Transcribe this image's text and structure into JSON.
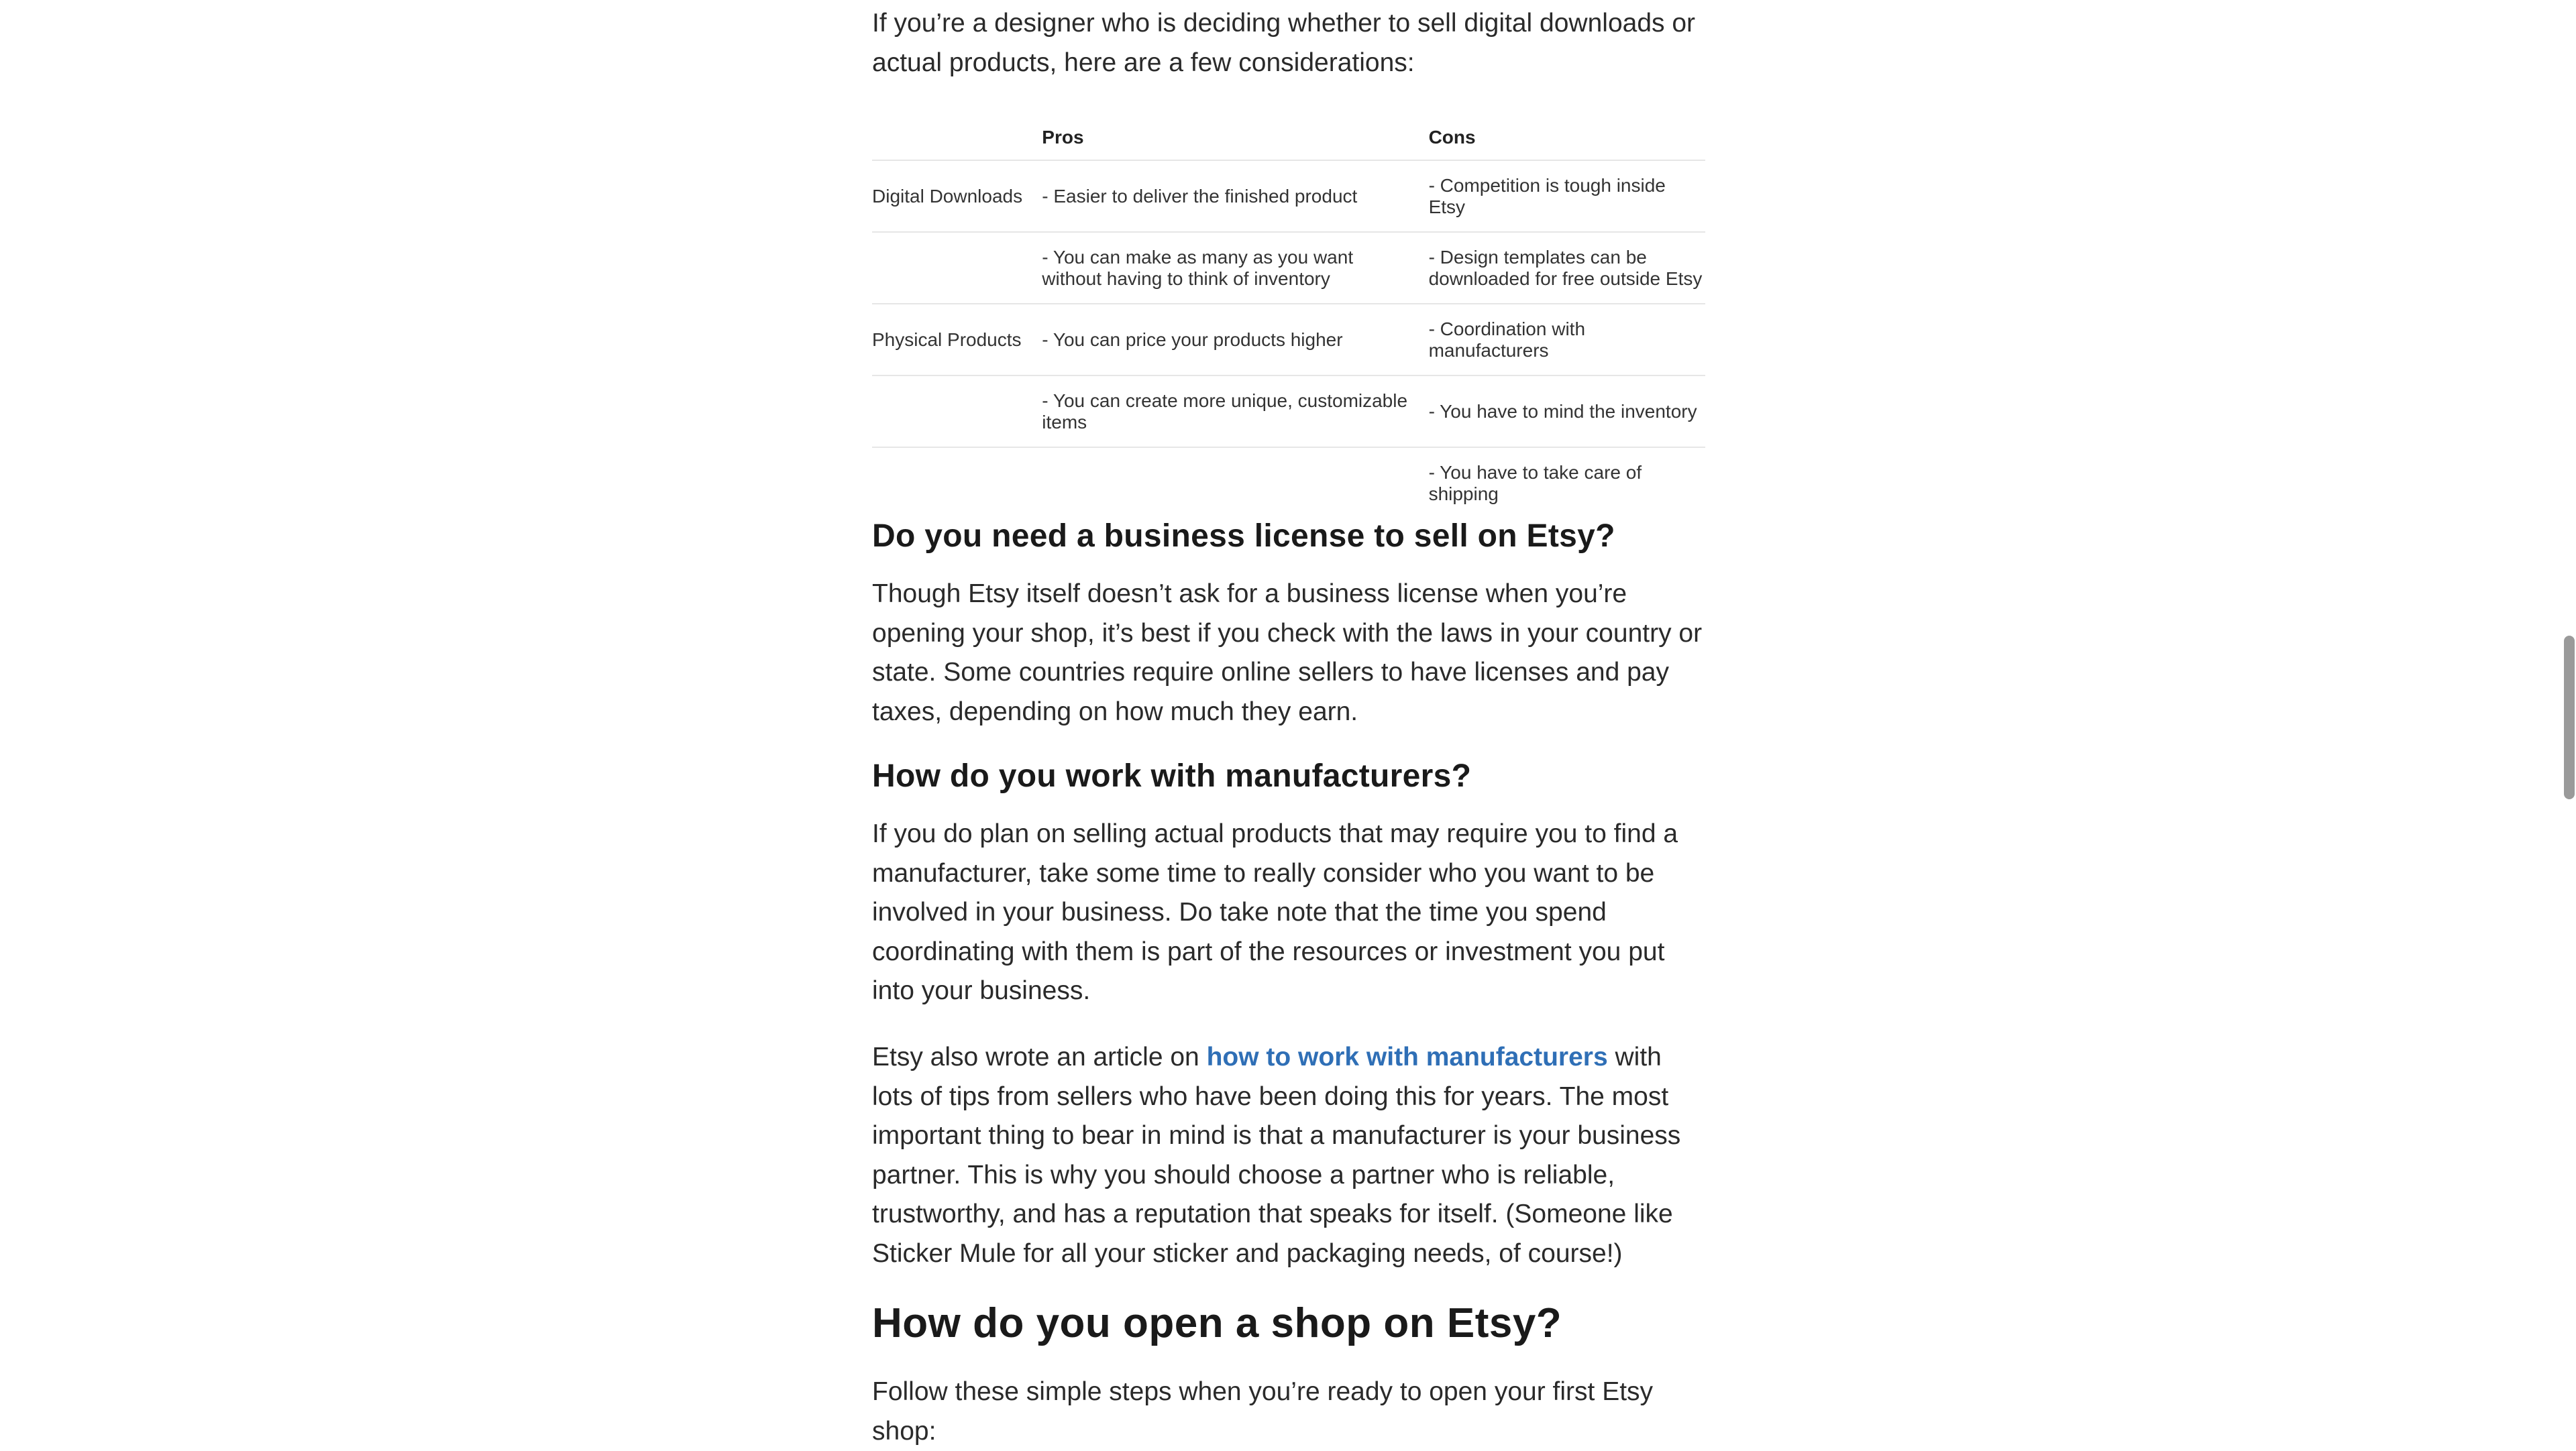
{
  "intro": "If you’re a designer who is deciding whether to sell digital downloads or actual products, here are a few considerations:",
  "table": {
    "headers": [
      "",
      "Pros",
      "Cons"
    ],
    "rows": [
      {
        "label": "Digital Downloads",
        "pro": "- Easier to deliver the finished product",
        "con": "- Competition is tough inside Etsy"
      },
      {
        "label": "",
        "pro": "- You can make as many as you want without having to think of inventory",
        "con": "- Design templates can be downloaded for free outside Etsy"
      },
      {
        "label": "Physical Products",
        "pro": "- You can price your products higher",
        "con": "- Coordination with manufacturers"
      },
      {
        "label": "",
        "pro": "- You can create more unique, customizable items",
        "con": "- You have to mind the inventory"
      },
      {
        "label": "",
        "pro": "",
        "con": "- You have to take care of shipping"
      }
    ]
  },
  "section_license": {
    "heading": "Do you need a business license to sell on Etsy?",
    "body": "Though Etsy itself doesn’t ask for a business license when you’re opening your shop, it’s best if you check with the laws in your country or state. Some countries require online sellers to have licenses and pay taxes, depending on how much they earn."
  },
  "section_manufacturers": {
    "heading": "How do you work with manufacturers?",
    "body": "If you do plan on selling actual products that may require you to find a manufacturer, take some time to really consider who you want to be involved in your business. Do take note that the time you spend coordinating with them is part of the resources or investment you put into your business.",
    "para2_before": "Etsy also wrote an article on ",
    "para2_link": "how to work with manufacturers",
    "para2_after": " with lots of tips from sellers who have been doing this for years. The most important thing to bear in mind is that a manufacturer is your business partner. This is why you should choose a partner who is reliable, trustworthy, and has a reputation that speaks for itself. (Someone like Sticker Mule for all your sticker and packaging needs, of course!)"
  },
  "section_open_shop": {
    "heading": "How do you open a shop on Etsy?",
    "body": "Follow these simple steps when you’re ready to open your first Etsy shop:"
  },
  "colors": {
    "link": "#2f6fb6",
    "text": "#2a2a2a",
    "divider": "#e6e6e6",
    "scroll_thumb": "#9a9a9a"
  }
}
